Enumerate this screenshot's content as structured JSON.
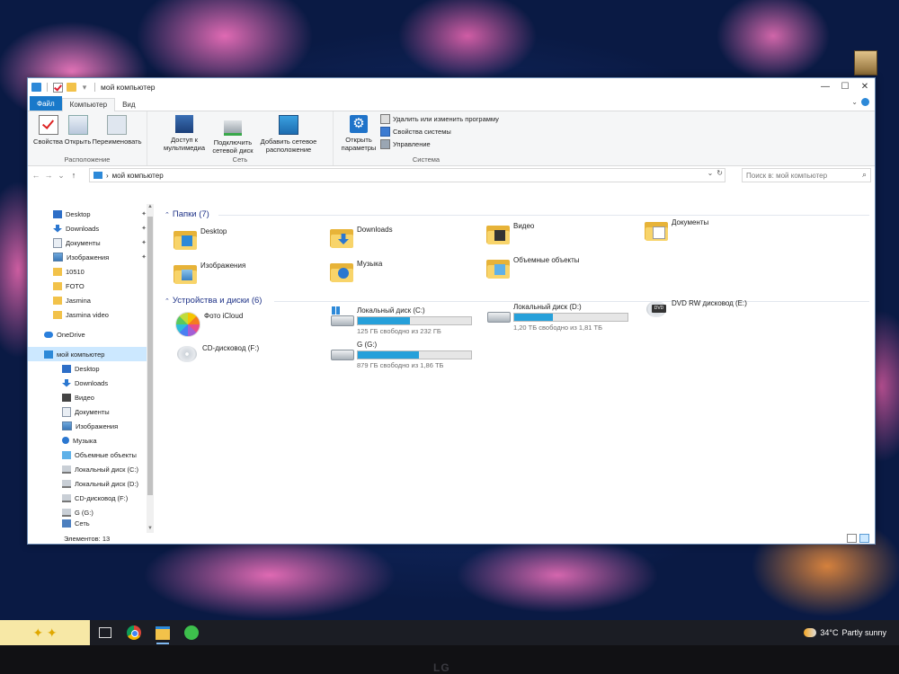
{
  "window": {
    "title": "мой компьютер",
    "controls": {
      "minimize": "—",
      "maximize": "☐",
      "close": "✕"
    }
  },
  "ribbon": {
    "tabs": [
      "Файл",
      "Компьютер",
      "Вид"
    ],
    "groups": {
      "location": {
        "label": "Расположение",
        "buttons": [
          "Свойства",
          "Открыть",
          "Переименовать"
        ]
      },
      "network": {
        "label": "Сеть",
        "buttons": [
          {
            "line1": "Доступ к",
            "line2": "мультимедиа"
          },
          {
            "line1": "Подключить",
            "line2": "сетевой диск"
          },
          {
            "line1": "Добавить сетевое",
            "line2": "расположение"
          }
        ]
      },
      "system": {
        "label": "Система",
        "open_settings": {
          "line1": "Открыть",
          "line2": "параметры"
        },
        "items": [
          "Удалить или изменить программу",
          "Свойства системы",
          "Управление"
        ]
      }
    }
  },
  "address": {
    "path": "мой компьютер",
    "search_placeholder": "Поиск в: мой компьютер"
  },
  "navpane": {
    "quick_access": [
      {
        "label": "Desktop",
        "icon": "desktop-icon",
        "pinned": true
      },
      {
        "label": "Downloads",
        "icon": "downloads-icon",
        "pinned": true
      },
      {
        "label": "Документы",
        "icon": "documents-icon",
        "pinned": true
      },
      {
        "label": "Изображения",
        "icon": "pictures-icon",
        "pinned": true
      },
      {
        "label": "10510",
        "icon": "folder-icon",
        "pinned": false
      },
      {
        "label": "FOTO",
        "icon": "folder-icon",
        "pinned": false
      },
      {
        "label": "Jasmina",
        "icon": "folder-icon",
        "pinned": false
      },
      {
        "label": "Jasmina video",
        "icon": "folder-icon",
        "pinned": false
      }
    ],
    "onedrive": "OneDrive",
    "this_pc": "мой компьютер",
    "pc_children": [
      {
        "label": "Desktop",
        "icon": "desktop-icon"
      },
      {
        "label": "Downloads",
        "icon": "downloads-icon"
      },
      {
        "label": "Видео",
        "icon": "video-icon"
      },
      {
        "label": "Документы",
        "icon": "documents-icon"
      },
      {
        "label": "Изображения",
        "icon": "pictures-icon"
      },
      {
        "label": "Музыка",
        "icon": "music-icon"
      },
      {
        "label": "Объемные объекты",
        "icon": "3d-objects-icon"
      },
      {
        "label": "Локальный диск (C:)",
        "icon": "windows-drive-icon"
      },
      {
        "label": "Локальный диск (D:)",
        "icon": "drive-icon"
      },
      {
        "label": "CD-дисковод (F:)",
        "icon": "cd-drive-icon"
      },
      {
        "label": "G (G:)",
        "icon": "drive-icon"
      },
      {
        "label": "Сеть",
        "icon": "network-icon"
      }
    ]
  },
  "content": {
    "folders_header": "Папки (7)",
    "folders": [
      "Desktop",
      "Downloads",
      "Видео",
      "Документы",
      "Изображения",
      "Музыка",
      "Объемные объекты"
    ],
    "devices_header": "Устройства и диски (6)",
    "devices": {
      "icloud": "Фото iCloud",
      "c": {
        "name": "Локальный диск (C:)",
        "free": "125 ГБ свободно из 232 ГБ",
        "used_fraction": 0.46
      },
      "d": {
        "name": "Локальный диск (D:)",
        "free": "1,20 ТБ свободно из 1,81 ТБ",
        "used_fraction": 0.34
      },
      "e": {
        "name": "DVD RW дисковод (E:)",
        "badge": "DVD"
      },
      "f": {
        "name": "CD-дисковод (F:)"
      },
      "g": {
        "name": "G (G:)",
        "free": "879 ГБ свободно из 1,86 ТБ",
        "used_fraction": 0.54
      }
    }
  },
  "status": {
    "items": "Элементов: 13"
  },
  "taskbar": {
    "weather_temp": "34°C",
    "weather_text": "Partly sunny"
  },
  "monitor": {
    "brand": "LG"
  }
}
